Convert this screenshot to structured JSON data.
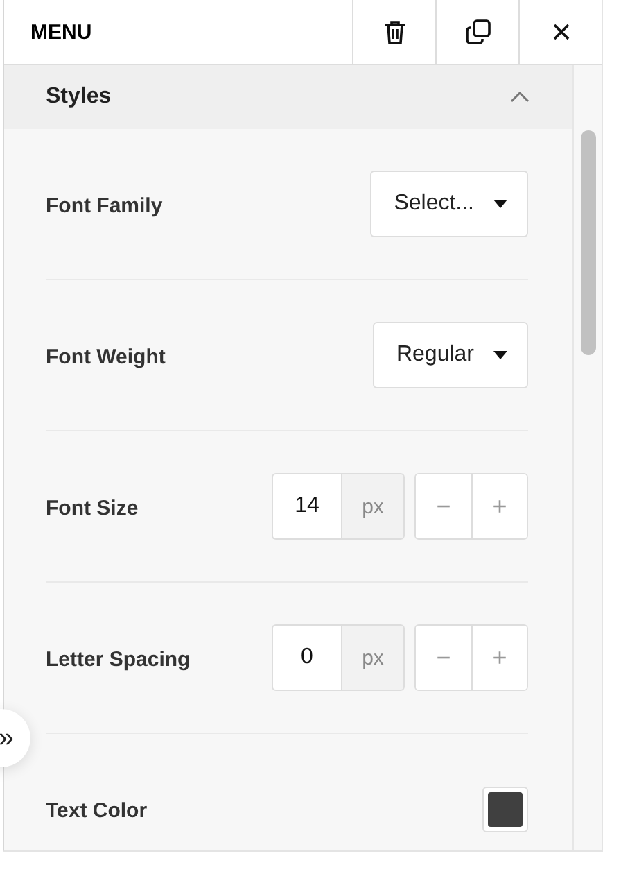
{
  "panel": {
    "title": "MENU",
    "actions": [
      {
        "kind": "delete"
      },
      {
        "kind": "duplicate"
      },
      {
        "kind": "close"
      }
    ]
  },
  "section": {
    "title": "Styles",
    "expanded": true
  },
  "properties": [
    {
      "kind": "select",
      "label": "Font Family",
      "value": "Select..."
    },
    {
      "kind": "select",
      "label": "Font Weight",
      "value": "Regular"
    },
    {
      "kind": "number",
      "label": "Font Size",
      "value": "14",
      "unit": "px",
      "decrement": "−",
      "increment": "+"
    },
    {
      "kind": "number",
      "label": "Letter Spacing",
      "value": "0",
      "unit": "px",
      "decrement": "−",
      "increment": "+"
    },
    {
      "kind": "color",
      "label": "Text Color",
      "color": "#404040"
    }
  ],
  "side_toggle": {
    "label": "»"
  }
}
